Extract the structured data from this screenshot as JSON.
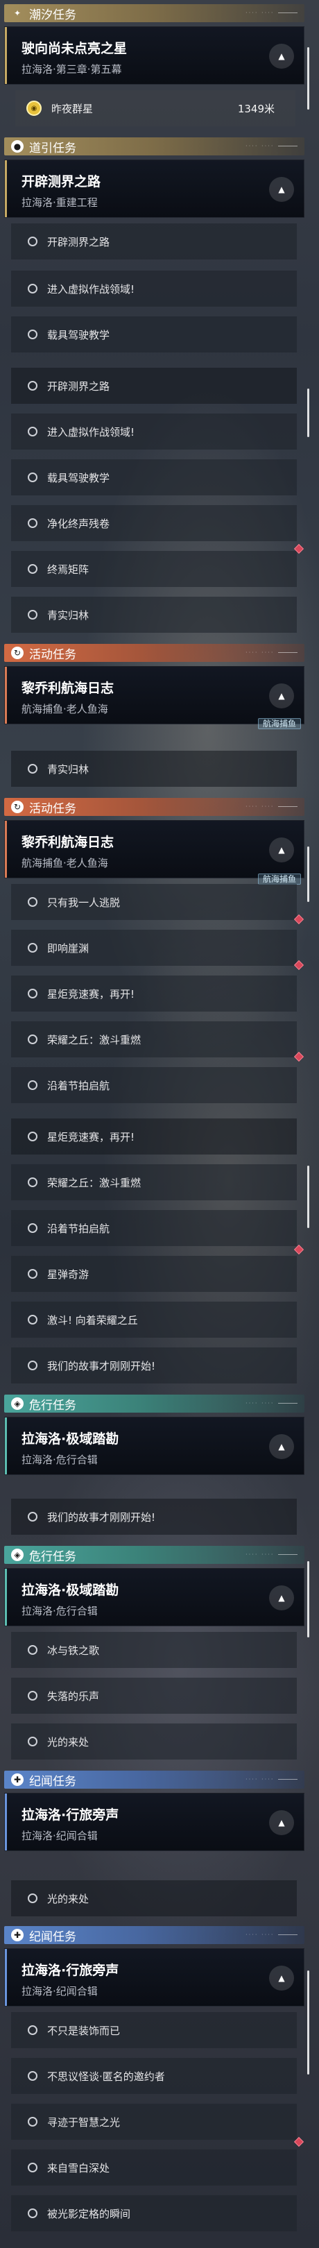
{
  "sections": {
    "tide": {
      "title": "潮汐任务",
      "icon": "star-plus-icon",
      "color": "#a38e5c"
    },
    "guide": {
      "title": "道引任务",
      "icon": "location-pin-icon",
      "color": "#a38e5c"
    },
    "event": {
      "title": "活动任务",
      "icon": "event-flag-icon",
      "color": "#d36a43"
    },
    "danger": {
      "title": "危行任务",
      "icon": "danger-icon",
      "color": "#4aa59c"
    },
    "record": {
      "title": "纪闻任务",
      "icon": "record-icon",
      "color": "#5b85c9"
    }
  },
  "quests": {
    "tide_main": {
      "title": "驶向尚未点亮之星",
      "subtitle": "拉海洛·第三章·第五幕"
    },
    "guide_main": {
      "title": "开辟测界之路",
      "subtitle": "拉海洛·重建工程"
    },
    "event_main": {
      "title": "黎乔利航海日志",
      "subtitle": "航海捕鱼·老人鱼海",
      "badge": "航海捕鱼"
    },
    "danger_main": {
      "title": "拉海洛·极域踏勘",
      "subtitle": "拉海洛·危行合辑"
    },
    "record_main": {
      "title": "拉海洛·行旅旁声",
      "subtitle": "拉海洛·纪闻合辑"
    }
  },
  "tracked_target": {
    "name": "昨夜群星",
    "distance": "1349米"
  },
  "guide_steps": [
    "开辟测界之路",
    "进入虚拟作战领域!",
    "载具驾驶教学",
    "净化终声残卷",
    "终焉矩阵",
    "青实归林"
  ],
  "event_steps": [
    "青实归林",
    "只有我一人逃脱",
    "即响崖渊",
    "星炬竞速赛，再开!",
    "荣耀之丘：激斗重燃",
    "沿着节拍启航",
    "星弹奇游",
    "激斗! 向着荣耀之丘",
    "我们的故事才刚刚开始!"
  ],
  "danger_steps": [
    "我们的故事才刚刚开始!",
    "冰与铁之歌",
    "失落的乐声",
    "光的来处"
  ],
  "record_steps": [
    "光的来处",
    "不只是装饰而已",
    "不思议怪谈·匿名的邀约者",
    "寻迹于智慧之光",
    "来自雪白深处",
    "被光影定格的瞬间"
  ],
  "colors": {
    "alert_diamond": "#d9475a",
    "coin": "#e8c23c"
  }
}
